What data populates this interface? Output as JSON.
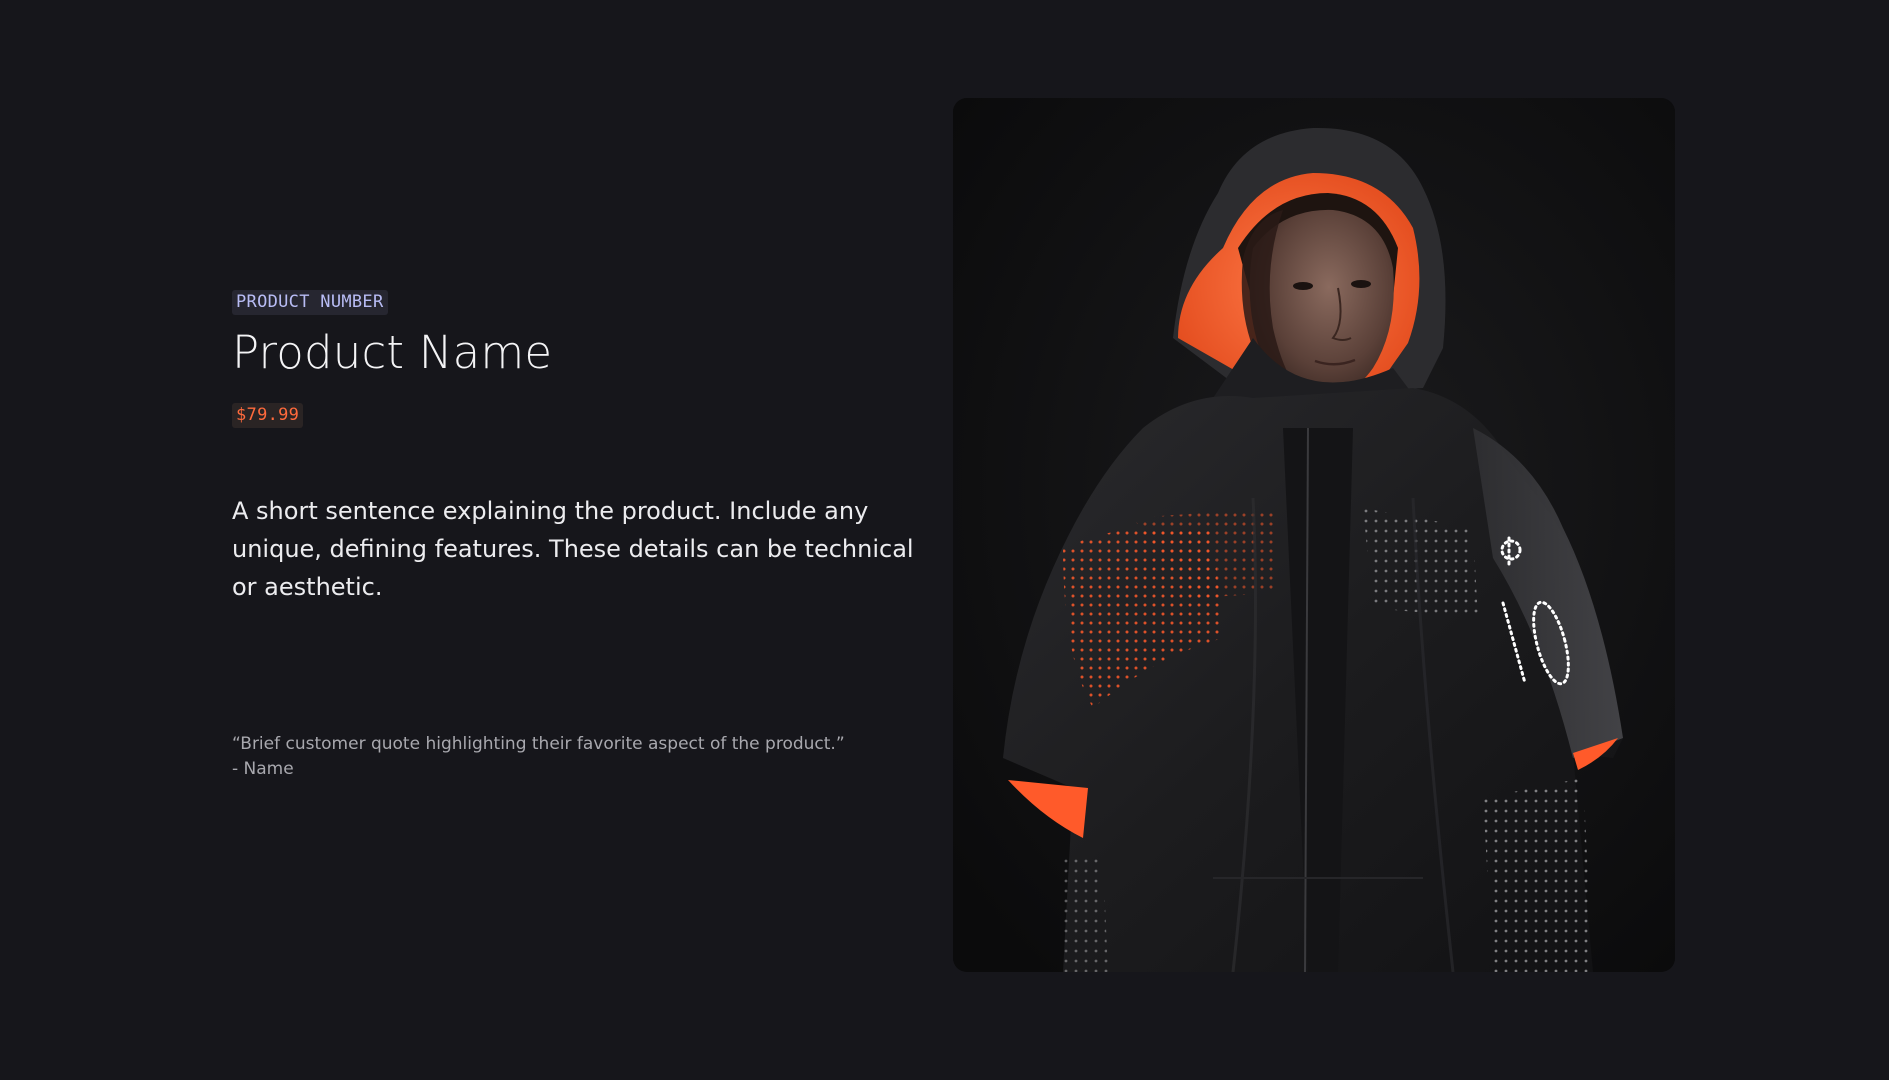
{
  "product": {
    "number_label": "PRODUCT NUMBER",
    "name": "Product Name",
    "price": "$79.99",
    "description": "A short sentence explaining the product. Include any unique, defining features. These details can be technical or aesthetic."
  },
  "testimonial": {
    "quote": "“Brief customer quote highlighting their favorite aspect of the product.”",
    "author": "- Name"
  },
  "colors": {
    "background": "#16161b",
    "accent_orange": "#ff6a3c",
    "tag_lavender": "#b8bcf4"
  },
  "image": {
    "subject": "person-in-hooded-light-jacket"
  }
}
